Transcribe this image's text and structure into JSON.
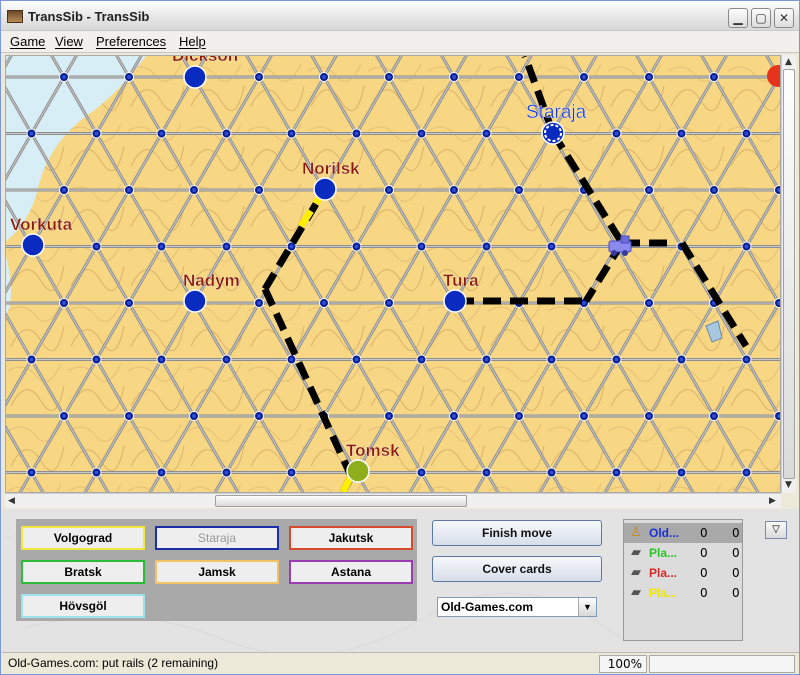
{
  "window": {
    "title": "TransSib - TransSib"
  },
  "menu": [
    {
      "label": "Game"
    },
    {
      "label": "View"
    },
    {
      "label": "Preferences"
    },
    {
      "label": "Help"
    }
  ],
  "map": {
    "cities": [
      {
        "name": "Dickson",
        "color": "#0a2bbf",
        "label_color": "#8b1a0a"
      },
      {
        "name": "Staraja",
        "color": "#0a2bbf",
        "label_color": "#1a3cd8",
        "selected": true
      },
      {
        "name": "Norilsk",
        "color": "#0a2bbf",
        "label_color": "#8b1a0a"
      },
      {
        "name": "Vorkuta",
        "color": "#0a2bbf",
        "label_color": "#8b1a0a"
      },
      {
        "name": "Nadym",
        "color": "#0a2bbf",
        "label_color": "#8b1a0a"
      },
      {
        "name": "Tura",
        "color": "#0a2bbf",
        "label_color": "#8b1a0a"
      },
      {
        "name": "Tomsk",
        "color": "#8fae1c",
        "label_color": "#8b1a0a"
      }
    ],
    "rail_colors": {
      "player": "#000000",
      "yellow_player": "#ffee00"
    },
    "icons": [
      "train-icon",
      "broken-rail-icon"
    ]
  },
  "cards": [
    {
      "label": "Volgograd",
      "border": "#f2e640",
      "enabled": true
    },
    {
      "label": "Staraja",
      "border": "#1b2fa6",
      "enabled": false
    },
    {
      "label": "Jakutsk",
      "border": "#d64a2e",
      "enabled": true
    },
    {
      "label": "Bratsk",
      "border": "#2dbb3a",
      "enabled": true
    },
    {
      "label": "Jamsk",
      "border": "#f1c267",
      "enabled": true
    },
    {
      "label": "Astana",
      "border": "#9c3cb2",
      "enabled": true
    },
    {
      "label": "Hövsgöl",
      "border": "#9ee2ec",
      "enabled": true
    }
  ],
  "actions": {
    "finish_move": "Finish move",
    "cover_cards": "Cover cards"
  },
  "player_select": {
    "value": "Old-Games.com"
  },
  "players": [
    {
      "name": "Old...",
      "color": "#1a33d8",
      "score1": "0",
      "score2": "0",
      "active": true,
      "icon": "person-icon"
    },
    {
      "name": "Pla...",
      "color": "#2cc22c",
      "score1": "0",
      "score2": "0",
      "active": false,
      "icon": "locomotive-icon"
    },
    {
      "name": "Pla...",
      "color": "#d42a2a",
      "score1": "0",
      "score2": "0",
      "active": false,
      "icon": "locomotive-icon"
    },
    {
      "name": "Pla...",
      "color": "#f0e600",
      "score1": "0",
      "score2": "0",
      "active": false,
      "icon": "locomotive-icon"
    }
  ],
  "status": {
    "message": "Old-Games.com: put rails (2 remaining)",
    "zoom": "100%"
  }
}
